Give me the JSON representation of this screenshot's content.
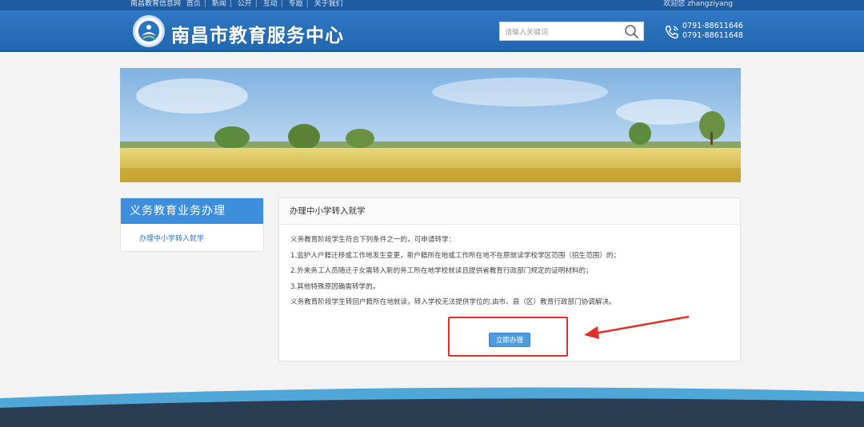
{
  "top_nav": {
    "items": [
      "南昌教育信息网",
      "首页",
      "新闻",
      "公开",
      "互动",
      "专题",
      "关于我们"
    ],
    "welcome": "欢迎您 zhangziyang"
  },
  "header": {
    "title": "南昌市教育服务中心",
    "search_placeholder": "请输入关键词",
    "phones": [
      "0791-88611646",
      "0791-88611648"
    ]
  },
  "sidebar": {
    "heading": "义务教育业务办理",
    "items": [
      {
        "label": "办理中小学转入就学"
      }
    ]
  },
  "content": {
    "title": "办理中小学转入就学",
    "paragraphs": [
      "义务教育阶段学生符合下列条件之一的，可申请转学：",
      "1.监护人户籍迁移或工作地发生变更，新户籍所在地或工作所在地不在原就读学校学区范围（招生范围）的；",
      "2.外来务工人员随迁子女需转入新的务工所在地学校就读且提供省教育行政部门规定的证明材料的；",
      "3.其他特殊原因确需转学的。",
      "义务教育阶段学生转回户籍所在地就读，转入学校无法提供学位的,由市、县（区）教育行政部门协调解决。"
    ],
    "apply_label": "立即办理"
  },
  "colors": {
    "header_blue": "#2166b0",
    "sidebar_blue": "#3e8fdb",
    "button_blue": "#4e9be0",
    "annotation_red": "#e0302a"
  },
  "icons": {
    "search": "search-icon",
    "phone": "phone-icon",
    "logo": "logo-emblem"
  }
}
